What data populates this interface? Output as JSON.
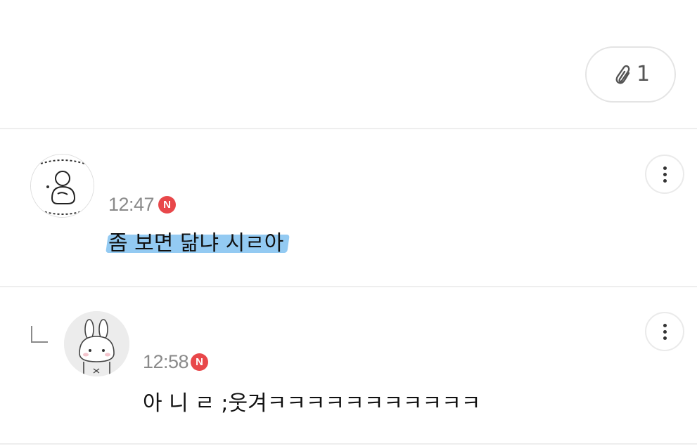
{
  "attachment": {
    "icon": "paperclip-icon",
    "count": "1"
  },
  "comments": [
    {
      "avatar_icon": "character-sticker-avatar",
      "time": "12:47",
      "new_badge": "N",
      "text": "좀 보면 닮냐 시ㄹ아",
      "highlighted": true,
      "more_icon": "vertical-dots-icon"
    },
    {
      "is_reply": true,
      "reply_icon": "reply-arrow-icon",
      "avatar_icon": "bunny-avatar",
      "time": "12:58",
      "new_badge": "N",
      "text": "아 니 ㄹ ;웃겨ㅋㅋㅋㅋㅋㅋㅋㅋㅋㅋㅋ",
      "more_icon": "vertical-dots-icon"
    }
  ],
  "colors": {
    "badge": "#e8474a",
    "highlight": "#6fb8ee",
    "time": "#8a8a8a",
    "divider": "#eeeeee"
  }
}
